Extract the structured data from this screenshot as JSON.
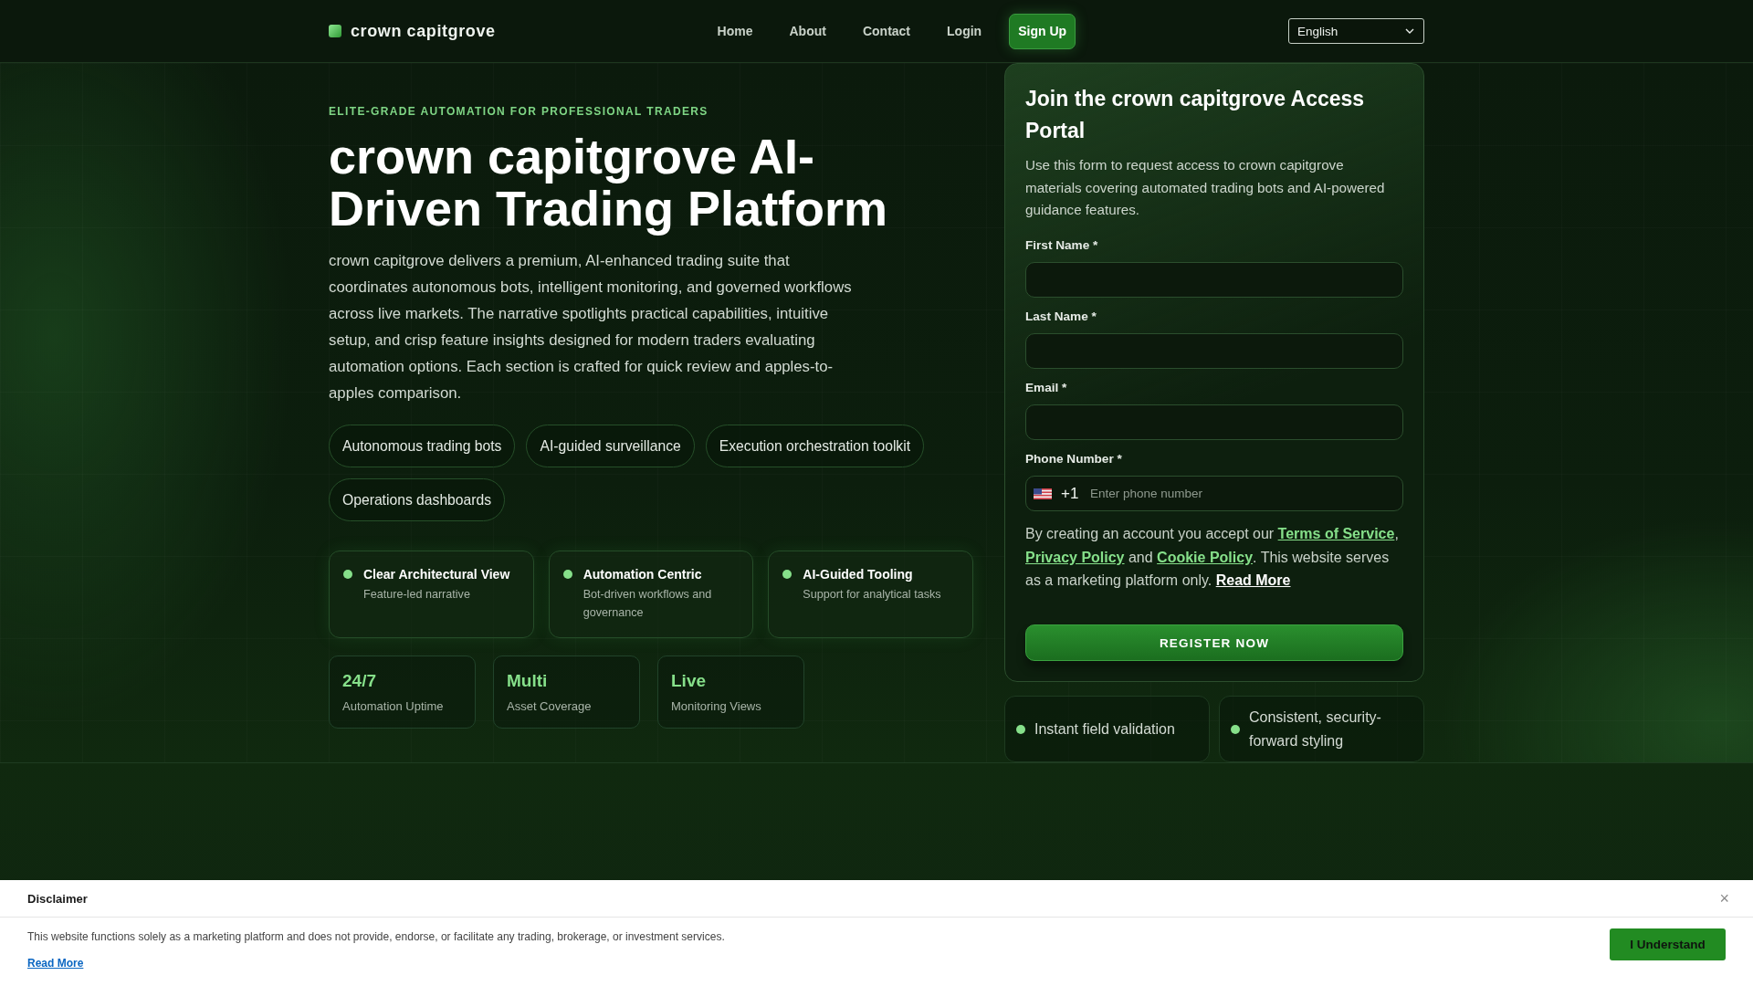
{
  "header": {
    "brand": "crown capitgrove",
    "nav": [
      {
        "label": "Home"
      },
      {
        "label": "About"
      },
      {
        "label": "Contact"
      },
      {
        "label": "Login"
      }
    ],
    "cta": "Sign Up",
    "language": "English"
  },
  "hero": {
    "eyebrow": "ELITE-GRADE AUTOMATION FOR PROFESSIONAL TRADERS",
    "title": "crown capitgrove AI-Driven Trading Platform",
    "intro": "crown capitgrove delivers a premium, AI-enhanced trading suite that coordinates autonomous bots, intelligent monitoring, and governed workflows across live markets. The narrative spotlights practical capabilities, intuitive setup, and crisp feature insights designed for modern traders evaluating automation options. Each section is crafted for quick review and apples-to-apples comparison.",
    "chips": [
      "Autonomous trading bots",
      "AI-guided surveillance",
      "Execution orchestration toolkit",
      "Operations dashboards"
    ],
    "features": [
      {
        "title": "Clear Architectural View",
        "text": "Feature-led narrative"
      },
      {
        "title": "Automation Centric",
        "text": "Bot-driven workflows and governance"
      },
      {
        "title": "AI-Guided Tooling",
        "text": "Support for analytical tasks"
      }
    ],
    "stats": [
      {
        "value": "24/7",
        "label": "Automation Uptime"
      },
      {
        "value": "Multi",
        "label": "Asset Coverage"
      },
      {
        "value": "Live",
        "label": "Monitoring Views"
      }
    ]
  },
  "form": {
    "title": "Join the crown capitgrove Access Portal",
    "description": "Use this form to request access to crown capitgrove materials covering automated trading bots and AI-powered guidance features.",
    "fields": [
      {
        "kind": "text",
        "label": "First Name *"
      },
      {
        "kind": "text",
        "label": "Last Name *"
      },
      {
        "kind": "text",
        "label": "Email *"
      },
      {
        "kind": "phone",
        "label": "Phone Number *",
        "prefix": "+1",
        "placeholder": "Enter phone number"
      }
    ],
    "consent": [
      {
        "kind": "text",
        "text": "By creating an account you accept our "
      },
      {
        "kind": "link",
        "text": "Terms of Service"
      },
      {
        "kind": "text",
        "text": ", "
      },
      {
        "kind": "link",
        "text": "Privacy Policy"
      },
      {
        "kind": "text",
        "text": " and "
      },
      {
        "kind": "link",
        "text": "Cookie Policy"
      },
      {
        "kind": "text",
        "text": ". This website serves as a marketing platform only. "
      },
      {
        "kind": "more",
        "text": "Read More"
      }
    ],
    "submit": "REGISTER NOW"
  },
  "highlights": [
    "Instant field validation",
    "Consistent, security-forward styling"
  ],
  "disclaimer": {
    "title": "Disclaimer",
    "close": "×",
    "text": "This website functions solely as a marketing platform and does not provide, endorse, or facilitate any trading, brokerage, or investment services.",
    "link": "Read More",
    "button": "I Understand"
  }
}
